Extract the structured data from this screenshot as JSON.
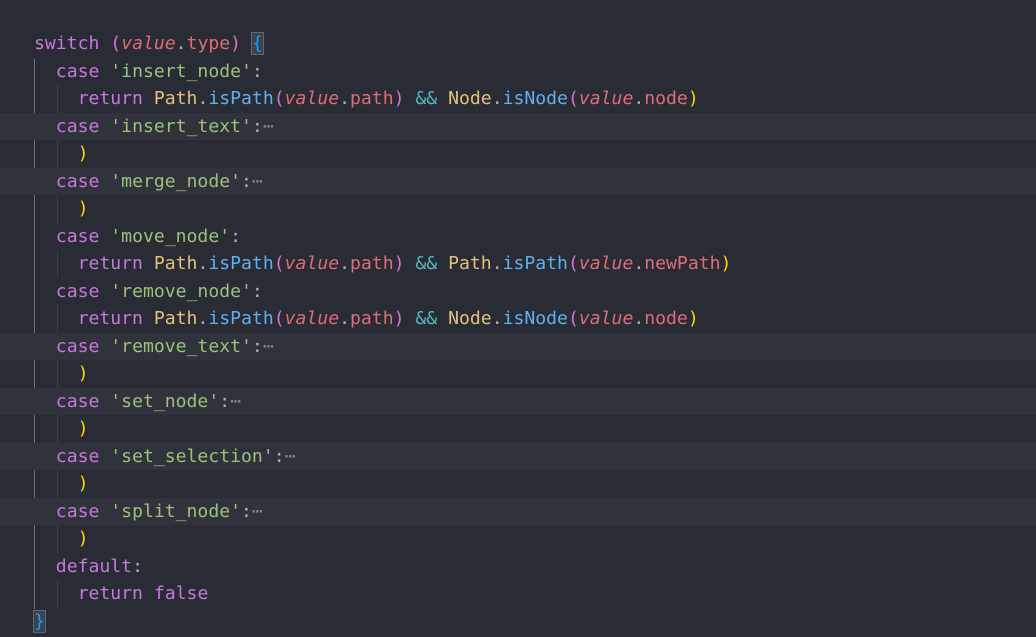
{
  "editor": {
    "lines": [
      {
        "indent": 0,
        "folded": false,
        "tokens": [
          {
            "t": "switch",
            "c": "kw"
          },
          {
            "t": " ",
            "c": "punc"
          },
          {
            "t": "(",
            "c": "paren2"
          },
          {
            "t": "value",
            "c": "var"
          },
          {
            "t": ".",
            "c": "punc"
          },
          {
            "t": "type",
            "c": "prop"
          },
          {
            "t": ")",
            "c": "paren2"
          },
          {
            "t": " ",
            "c": "punc"
          },
          {
            "t": "{",
            "c": "paren3",
            "match": true
          }
        ]
      },
      {
        "indent": 1,
        "folded": false,
        "tokens": [
          {
            "t": "case",
            "c": "kw"
          },
          {
            "t": " ",
            "c": "punc"
          },
          {
            "t": "'insert_node'",
            "c": "str"
          },
          {
            "t": ":",
            "c": "punc"
          }
        ]
      },
      {
        "indent": 2,
        "folded": false,
        "tokens": [
          {
            "t": "return",
            "c": "kw"
          },
          {
            "t": " ",
            "c": "punc"
          },
          {
            "t": "Path",
            "c": "cls"
          },
          {
            "t": ".",
            "c": "punc"
          },
          {
            "t": "isPath",
            "c": "fn"
          },
          {
            "t": "(",
            "c": "paren2"
          },
          {
            "t": "value",
            "c": "var"
          },
          {
            "t": ".",
            "c": "punc"
          },
          {
            "t": "path",
            "c": "prop"
          },
          {
            "t": ")",
            "c": "paren2"
          },
          {
            "t": " ",
            "c": "punc"
          },
          {
            "t": "&&",
            "c": "op"
          },
          {
            "t": " ",
            "c": "punc"
          },
          {
            "t": "Node",
            "c": "cls"
          },
          {
            "t": ".",
            "c": "punc"
          },
          {
            "t": "isNode",
            "c": "fn"
          },
          {
            "t": "(",
            "c": "paren2"
          },
          {
            "t": "value",
            "c": "var"
          },
          {
            "t": ".",
            "c": "punc"
          },
          {
            "t": "node",
            "c": "prop"
          },
          {
            "t": ")",
            "c": "paren1"
          }
        ]
      },
      {
        "indent": 1,
        "folded": true,
        "tokens": [
          {
            "t": "case",
            "c": "kw"
          },
          {
            "t": " ",
            "c": "punc"
          },
          {
            "t": "'insert_text'",
            "c": "str"
          },
          {
            "t": ":",
            "c": "punc"
          },
          {
            "t": "⋯",
            "c": "ellipsis"
          }
        ]
      },
      {
        "indent": 2,
        "folded": false,
        "tokens": [
          {
            "t": ")",
            "c": "paren1"
          }
        ]
      },
      {
        "indent": 1,
        "folded": true,
        "tokens": [
          {
            "t": "case",
            "c": "kw"
          },
          {
            "t": " ",
            "c": "punc"
          },
          {
            "t": "'merge_node'",
            "c": "str"
          },
          {
            "t": ":",
            "c": "punc"
          },
          {
            "t": "⋯",
            "c": "ellipsis"
          }
        ]
      },
      {
        "indent": 2,
        "folded": false,
        "tokens": [
          {
            "t": ")",
            "c": "paren1"
          }
        ]
      },
      {
        "indent": 1,
        "folded": false,
        "tokens": [
          {
            "t": "case",
            "c": "kw"
          },
          {
            "t": " ",
            "c": "punc"
          },
          {
            "t": "'move_node'",
            "c": "str"
          },
          {
            "t": ":",
            "c": "punc"
          }
        ]
      },
      {
        "indent": 2,
        "folded": false,
        "tokens": [
          {
            "t": "return",
            "c": "kw"
          },
          {
            "t": " ",
            "c": "punc"
          },
          {
            "t": "Path",
            "c": "cls"
          },
          {
            "t": ".",
            "c": "punc"
          },
          {
            "t": "isPath",
            "c": "fn"
          },
          {
            "t": "(",
            "c": "paren2"
          },
          {
            "t": "value",
            "c": "var"
          },
          {
            "t": ".",
            "c": "punc"
          },
          {
            "t": "path",
            "c": "prop"
          },
          {
            "t": ")",
            "c": "paren2"
          },
          {
            "t": " ",
            "c": "punc"
          },
          {
            "t": "&&",
            "c": "op"
          },
          {
            "t": " ",
            "c": "punc"
          },
          {
            "t": "Path",
            "c": "cls"
          },
          {
            "t": ".",
            "c": "punc"
          },
          {
            "t": "isPath",
            "c": "fn"
          },
          {
            "t": "(",
            "c": "paren2"
          },
          {
            "t": "value",
            "c": "var"
          },
          {
            "t": ".",
            "c": "punc"
          },
          {
            "t": "newPath",
            "c": "prop"
          },
          {
            "t": ")",
            "c": "paren1"
          }
        ]
      },
      {
        "indent": 1,
        "folded": false,
        "tokens": [
          {
            "t": "case",
            "c": "kw"
          },
          {
            "t": " ",
            "c": "punc"
          },
          {
            "t": "'remove_node'",
            "c": "str"
          },
          {
            "t": ":",
            "c": "punc"
          }
        ]
      },
      {
        "indent": 2,
        "folded": false,
        "tokens": [
          {
            "t": "return",
            "c": "kw"
          },
          {
            "t": " ",
            "c": "punc"
          },
          {
            "t": "Path",
            "c": "cls"
          },
          {
            "t": ".",
            "c": "punc"
          },
          {
            "t": "isPath",
            "c": "fn"
          },
          {
            "t": "(",
            "c": "paren2"
          },
          {
            "t": "value",
            "c": "var"
          },
          {
            "t": ".",
            "c": "punc"
          },
          {
            "t": "path",
            "c": "prop"
          },
          {
            "t": ")",
            "c": "paren2"
          },
          {
            "t": " ",
            "c": "punc"
          },
          {
            "t": "&&",
            "c": "op"
          },
          {
            "t": " ",
            "c": "punc"
          },
          {
            "t": "Node",
            "c": "cls"
          },
          {
            "t": ".",
            "c": "punc"
          },
          {
            "t": "isNode",
            "c": "fn"
          },
          {
            "t": "(",
            "c": "paren2"
          },
          {
            "t": "value",
            "c": "var"
          },
          {
            "t": ".",
            "c": "punc"
          },
          {
            "t": "node",
            "c": "prop"
          },
          {
            "t": ")",
            "c": "paren1"
          }
        ]
      },
      {
        "indent": 1,
        "folded": true,
        "tokens": [
          {
            "t": "case",
            "c": "kw"
          },
          {
            "t": " ",
            "c": "punc"
          },
          {
            "t": "'remove_text'",
            "c": "str"
          },
          {
            "t": ":",
            "c": "punc"
          },
          {
            "t": "⋯",
            "c": "ellipsis"
          }
        ]
      },
      {
        "indent": 2,
        "folded": false,
        "tokens": [
          {
            "t": ")",
            "c": "paren1"
          }
        ]
      },
      {
        "indent": 1,
        "folded": true,
        "tokens": [
          {
            "t": "case",
            "c": "kw"
          },
          {
            "t": " ",
            "c": "punc"
          },
          {
            "t": "'set_node'",
            "c": "str"
          },
          {
            "t": ":",
            "c": "punc"
          },
          {
            "t": "⋯",
            "c": "ellipsis"
          }
        ]
      },
      {
        "indent": 2,
        "folded": false,
        "tokens": [
          {
            "t": ")",
            "c": "paren1"
          }
        ]
      },
      {
        "indent": 1,
        "folded": true,
        "tokens": [
          {
            "t": "case",
            "c": "kw"
          },
          {
            "t": " ",
            "c": "punc"
          },
          {
            "t": "'set_selection'",
            "c": "str"
          },
          {
            "t": ":",
            "c": "punc"
          },
          {
            "t": "⋯",
            "c": "ellipsis"
          }
        ]
      },
      {
        "indent": 2,
        "folded": false,
        "tokens": [
          {
            "t": ")",
            "c": "paren1"
          }
        ]
      },
      {
        "indent": 1,
        "folded": true,
        "tokens": [
          {
            "t": "case",
            "c": "kw"
          },
          {
            "t": " ",
            "c": "punc"
          },
          {
            "t": "'split_node'",
            "c": "str"
          },
          {
            "t": ":",
            "c": "punc"
          },
          {
            "t": "⋯",
            "c": "ellipsis"
          }
        ]
      },
      {
        "indent": 2,
        "folded": false,
        "tokens": [
          {
            "t": ")",
            "c": "paren1"
          }
        ]
      },
      {
        "indent": 1,
        "folded": false,
        "tokens": [
          {
            "t": "default",
            "c": "kw"
          },
          {
            "t": ":",
            "c": "punc"
          }
        ]
      },
      {
        "indent": 2,
        "folded": false,
        "tokens": [
          {
            "t": "return",
            "c": "kw"
          },
          {
            "t": " ",
            "c": "punc"
          },
          {
            "t": "false",
            "c": "kw"
          }
        ]
      },
      {
        "indent": 0,
        "folded": false,
        "tokens": [
          {
            "t": "}",
            "c": "paren3",
            "match": true
          }
        ]
      }
    ]
  },
  "colors": {
    "background": "#292c34",
    "folded_line": "#30333b",
    "keyword": "#c678dd",
    "string": "#98c379",
    "class": "#e5c07b",
    "function": "#61afef",
    "variable": "#e06c75",
    "operator": "#56b6c2"
  }
}
